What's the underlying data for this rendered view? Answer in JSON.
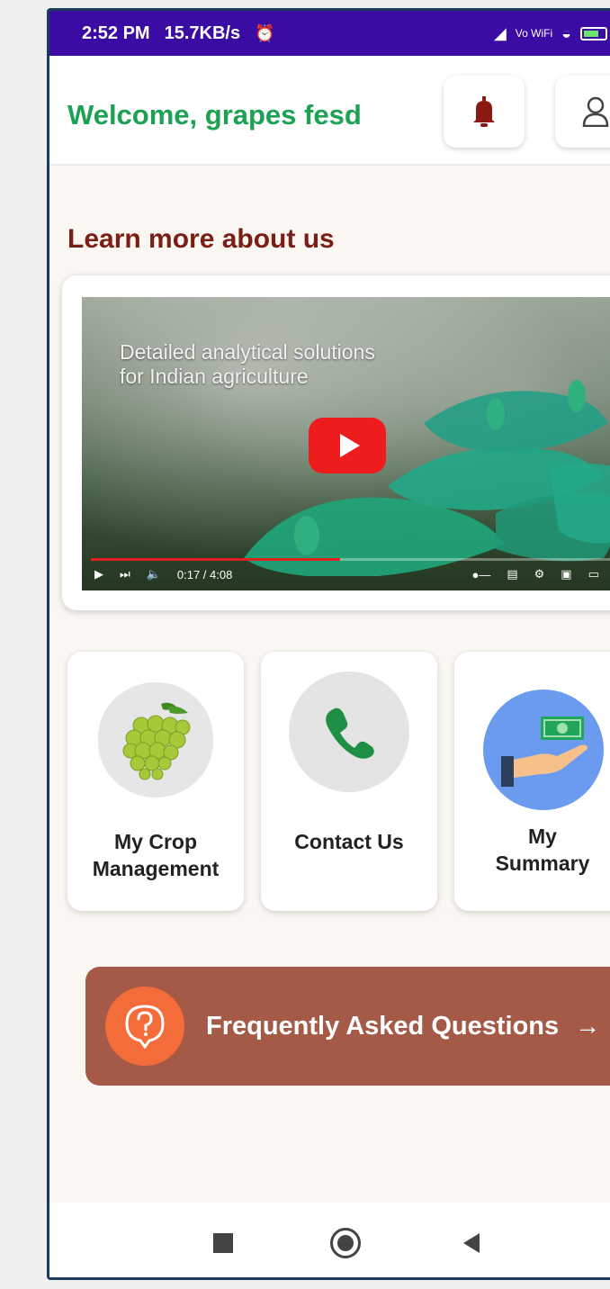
{
  "status_bar": {
    "time": "2:52 PM",
    "speed": "15.7KB/s",
    "alarm_icons": "⏰",
    "signal": "◢",
    "network": "Vo WiFi",
    "wifi": "◒"
  },
  "header": {
    "welcome": "Welcome, grapes fesd",
    "welcome_color": "#1da152",
    "notification_icon": "bell-icon",
    "profile_icon": "user-icon"
  },
  "section": {
    "title": "Learn more about us"
  },
  "video": {
    "overlay_text_line1": "Detailed analytical solutions",
    "overlay_text_line2": "for Indian agriculture",
    "time_label": "0:17 / 4:08",
    "progress_fraction": 0.47,
    "play_color": "#ee1c1c"
  },
  "cards": [
    {
      "line1": "My Crop",
      "line2": "Management",
      "icon": "grapes-icon"
    },
    {
      "line1": "Contact Us",
      "line2": "",
      "icon": "phone-icon"
    },
    {
      "line1": "My",
      "line2": "Summary",
      "icon": "money-hand-icon"
    }
  ],
  "faq": {
    "label": "Frequently Asked Questions",
    "arrow": "→",
    "icon": "question-icon",
    "bg_color": "#a55a48"
  },
  "navbar": {
    "recent": "square-icon",
    "home": "circle-icon",
    "back": "back-triangle-icon"
  }
}
